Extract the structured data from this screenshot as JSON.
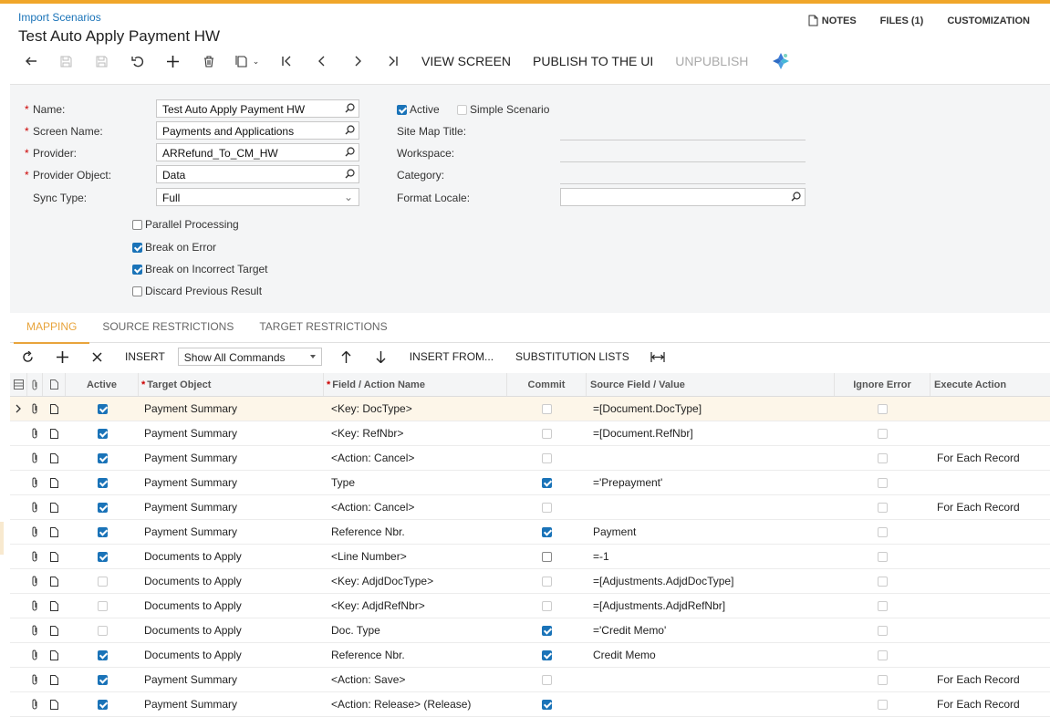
{
  "breadcrumb": "Import Scenarios",
  "title": "Test Auto Apply Payment HW",
  "top_links": {
    "notes": "NOTES",
    "files": "FILES (1)",
    "customization": "CUSTOMIZATION"
  },
  "toolbar": {
    "view_screen": "VIEW SCREEN",
    "publish": "PUBLISH TO THE UI",
    "unpublish": "UNPUBLISH"
  },
  "form": {
    "name_label": "Name:",
    "name_value": "Test Auto Apply Payment HW",
    "screen_label": "Screen Name:",
    "screen_value": "Payments and Applications",
    "provider_label": "Provider:",
    "provider_value": "ARRefund_To_CM_HW",
    "provider_obj_label": "Provider Object:",
    "provider_obj_value": "Data",
    "sync_label": "Sync Type:",
    "sync_value": "Full",
    "active_label": "Active",
    "simple_label": "Simple Scenario",
    "sitemap_label": "Site Map Title:",
    "workspace_label": "Workspace:",
    "category_label": "Category:",
    "locale_label": "Format Locale:",
    "parallel_label": "Parallel Processing",
    "break_error_label": "Break on Error",
    "break_target_label": "Break on Incorrect Target",
    "discard_label": "Discard Previous Result"
  },
  "tabs": [
    "MAPPING",
    "SOURCE RESTRICTIONS",
    "TARGET RESTRICTIONS"
  ],
  "grid_toolbar": {
    "insert": "INSERT",
    "command_filter": "Show All Commands",
    "insert_from": "INSERT FROM...",
    "substitution": "SUBSTITUTION LISTS"
  },
  "grid": {
    "headers": {
      "active": "Active",
      "target": "Target Object",
      "field": "Field / Action Name",
      "commit": "Commit",
      "source": "Source Field / Value",
      "ignore": "Ignore Error",
      "execute": "Execute Action"
    },
    "rows": [
      {
        "active": true,
        "target": "Payment Summary",
        "field": "<Key: DocType>",
        "commit": false,
        "commit_disabled": true,
        "source": "=[Document.DocType]",
        "ignore": false,
        "execute": ""
      },
      {
        "active": true,
        "target": "Payment Summary",
        "field": "<Key: RefNbr>",
        "commit": false,
        "commit_disabled": true,
        "source": "=[Document.RefNbr]",
        "ignore": false,
        "execute": ""
      },
      {
        "active": true,
        "target": "Payment Summary",
        "field": "<Action: Cancel>",
        "commit": false,
        "commit_disabled": true,
        "source": "",
        "ignore": false,
        "execute": "For Each Record"
      },
      {
        "active": true,
        "target": "Payment Summary",
        "field": "Type",
        "commit": true,
        "commit_disabled": false,
        "source": "='Prepayment'",
        "ignore": false,
        "execute": ""
      },
      {
        "active": true,
        "target": "Payment Summary",
        "field": "<Action: Cancel>",
        "commit": false,
        "commit_disabled": true,
        "source": "",
        "ignore": false,
        "execute": "For Each Record"
      },
      {
        "active": true,
        "target": "Payment Summary",
        "field": "Reference Nbr.",
        "commit": true,
        "commit_disabled": false,
        "source": "Payment",
        "ignore": false,
        "execute": ""
      },
      {
        "active": true,
        "target": "Documents to Apply",
        "field": "<Line Number>",
        "commit": false,
        "commit_disabled": false,
        "source": "=-1",
        "ignore": false,
        "execute": ""
      },
      {
        "active": false,
        "target": "Documents to Apply",
        "field": "<Key: AdjdDocType>",
        "commit": false,
        "commit_disabled": true,
        "source": "=[Adjustments.AdjdDocType]",
        "ignore": false,
        "execute": ""
      },
      {
        "active": false,
        "target": "Documents to Apply",
        "field": "<Key: AdjdRefNbr>",
        "commit": false,
        "commit_disabled": true,
        "source": "=[Adjustments.AdjdRefNbr]",
        "ignore": false,
        "execute": ""
      },
      {
        "active": false,
        "target": "Documents to Apply",
        "field": "Doc. Type",
        "commit": true,
        "commit_disabled": false,
        "source": "='Credit Memo'",
        "ignore": false,
        "execute": ""
      },
      {
        "active": true,
        "target": "Documents to Apply",
        "field": "Reference Nbr.",
        "commit": true,
        "commit_disabled": false,
        "source": "Credit Memo",
        "ignore": false,
        "execute": ""
      },
      {
        "active": true,
        "target": "Payment Summary",
        "field": "<Action: Save>",
        "commit": false,
        "commit_disabled": true,
        "source": "",
        "ignore": false,
        "execute": "For Each Record"
      },
      {
        "active": true,
        "target": "Payment Summary",
        "field": "<Action: Release> (Release)",
        "commit": true,
        "commit_disabled": false,
        "source": "",
        "ignore": false,
        "execute": "For Each Record"
      }
    ]
  },
  "colors": {
    "accent": "#f0a62a",
    "link": "#1a73b8",
    "form_bg": "#f4f5f6"
  }
}
